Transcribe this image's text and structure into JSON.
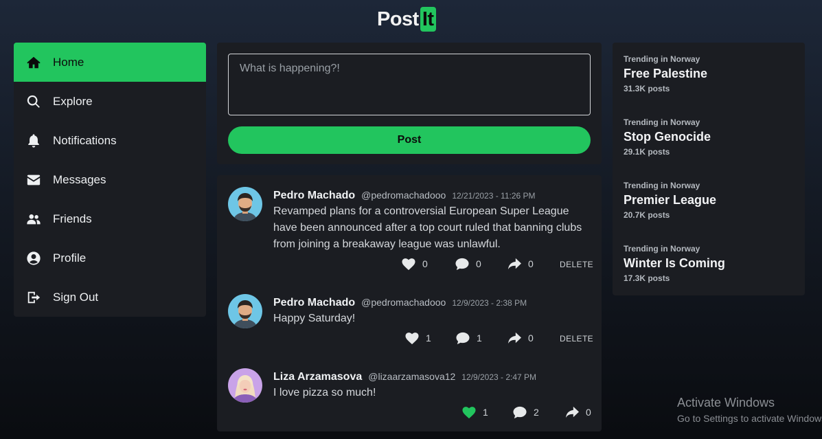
{
  "logo": {
    "text": "Post",
    "accent_text": "It",
    "accent_color": "#22c55e"
  },
  "sidebar": {
    "items": [
      {
        "label": "Home",
        "icon": "home-icon",
        "active": true
      },
      {
        "label": "Explore",
        "icon": "search-icon"
      },
      {
        "label": "Notifications",
        "icon": "bell-icon"
      },
      {
        "label": "Messages",
        "icon": "envelope-icon"
      },
      {
        "label": "Friends",
        "icon": "users-icon"
      },
      {
        "label": "Profile",
        "icon": "user-circle-icon"
      },
      {
        "label": "Sign Out",
        "icon": "sign-out-icon"
      }
    ]
  },
  "composer": {
    "placeholder": "What is happening?!",
    "value": "",
    "post_label": "Post"
  },
  "feed": {
    "posts": [
      {
        "author": "Pedro Machado",
        "handle": "@pedromachadooo",
        "time": "12/21/2023 - 11:26 PM",
        "text": "Revamped plans for a controversial European Super League have been announced after a top court ruled that banning clubs from joining a breakaway league was unlawful.",
        "likes": "0",
        "comments": "0",
        "shares": "0",
        "liked": false,
        "delete_label": "DELETE",
        "avatar": "avatar-man-icon"
      },
      {
        "author": "Pedro Machado",
        "handle": "@pedromachadooo",
        "time": "12/9/2023 - 2:38 PM",
        "text": "Happy Saturday!",
        "likes": "1",
        "comments": "1",
        "shares": "0",
        "liked": false,
        "delete_label": "DELETE",
        "avatar": "avatar-man-icon"
      },
      {
        "author": "Liza Arzamasova",
        "handle": "@lizaarzamasova12",
        "time": "12/9/2023 - 2:47 PM",
        "text": "I love pizza so much!",
        "likes": "1",
        "comments": "2",
        "shares": "0",
        "liked": true,
        "avatar": "avatar-woman-icon"
      }
    ]
  },
  "trending": {
    "items": [
      {
        "location": "Trending in Norway",
        "title": "Free Palestine",
        "count": "31.3K posts"
      },
      {
        "location": "Trending in Norway",
        "title": "Stop Genocide",
        "count": "29.1K posts"
      },
      {
        "location": "Trending in Norway",
        "title": "Premier League",
        "count": "20.7K posts"
      },
      {
        "location": "Trending in Norway",
        "title": "Winter Is Coming",
        "count": "17.3K posts"
      }
    ]
  },
  "watermark": {
    "title": "Activate Windows",
    "subtitle": "Go to Settings to activate Windows."
  }
}
